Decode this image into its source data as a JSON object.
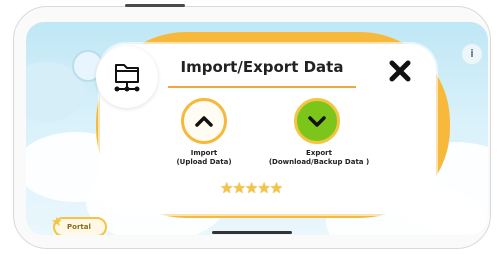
{
  "dialog": {
    "title": "Import/Export Data",
    "close_icon": "close-icon",
    "folder_icon": "folder-network-icon",
    "import": {
      "line1": "Import",
      "line2": "(Upload Data)",
      "icon": "chevron-up-icon",
      "color": "#f6b93b"
    },
    "export": {
      "line1": "Export",
      "line2": "(Download/Backup Data )",
      "icon": "chevron-down-icon",
      "color": "#7cc51a"
    },
    "rating_stars": "★★★★★"
  },
  "background": {
    "portal_button": "Portal",
    "info_button": "i"
  },
  "colors": {
    "accent_orange": "#f6b93b",
    "accent_green": "#7cc51a",
    "sky": "#bfe7f5"
  }
}
